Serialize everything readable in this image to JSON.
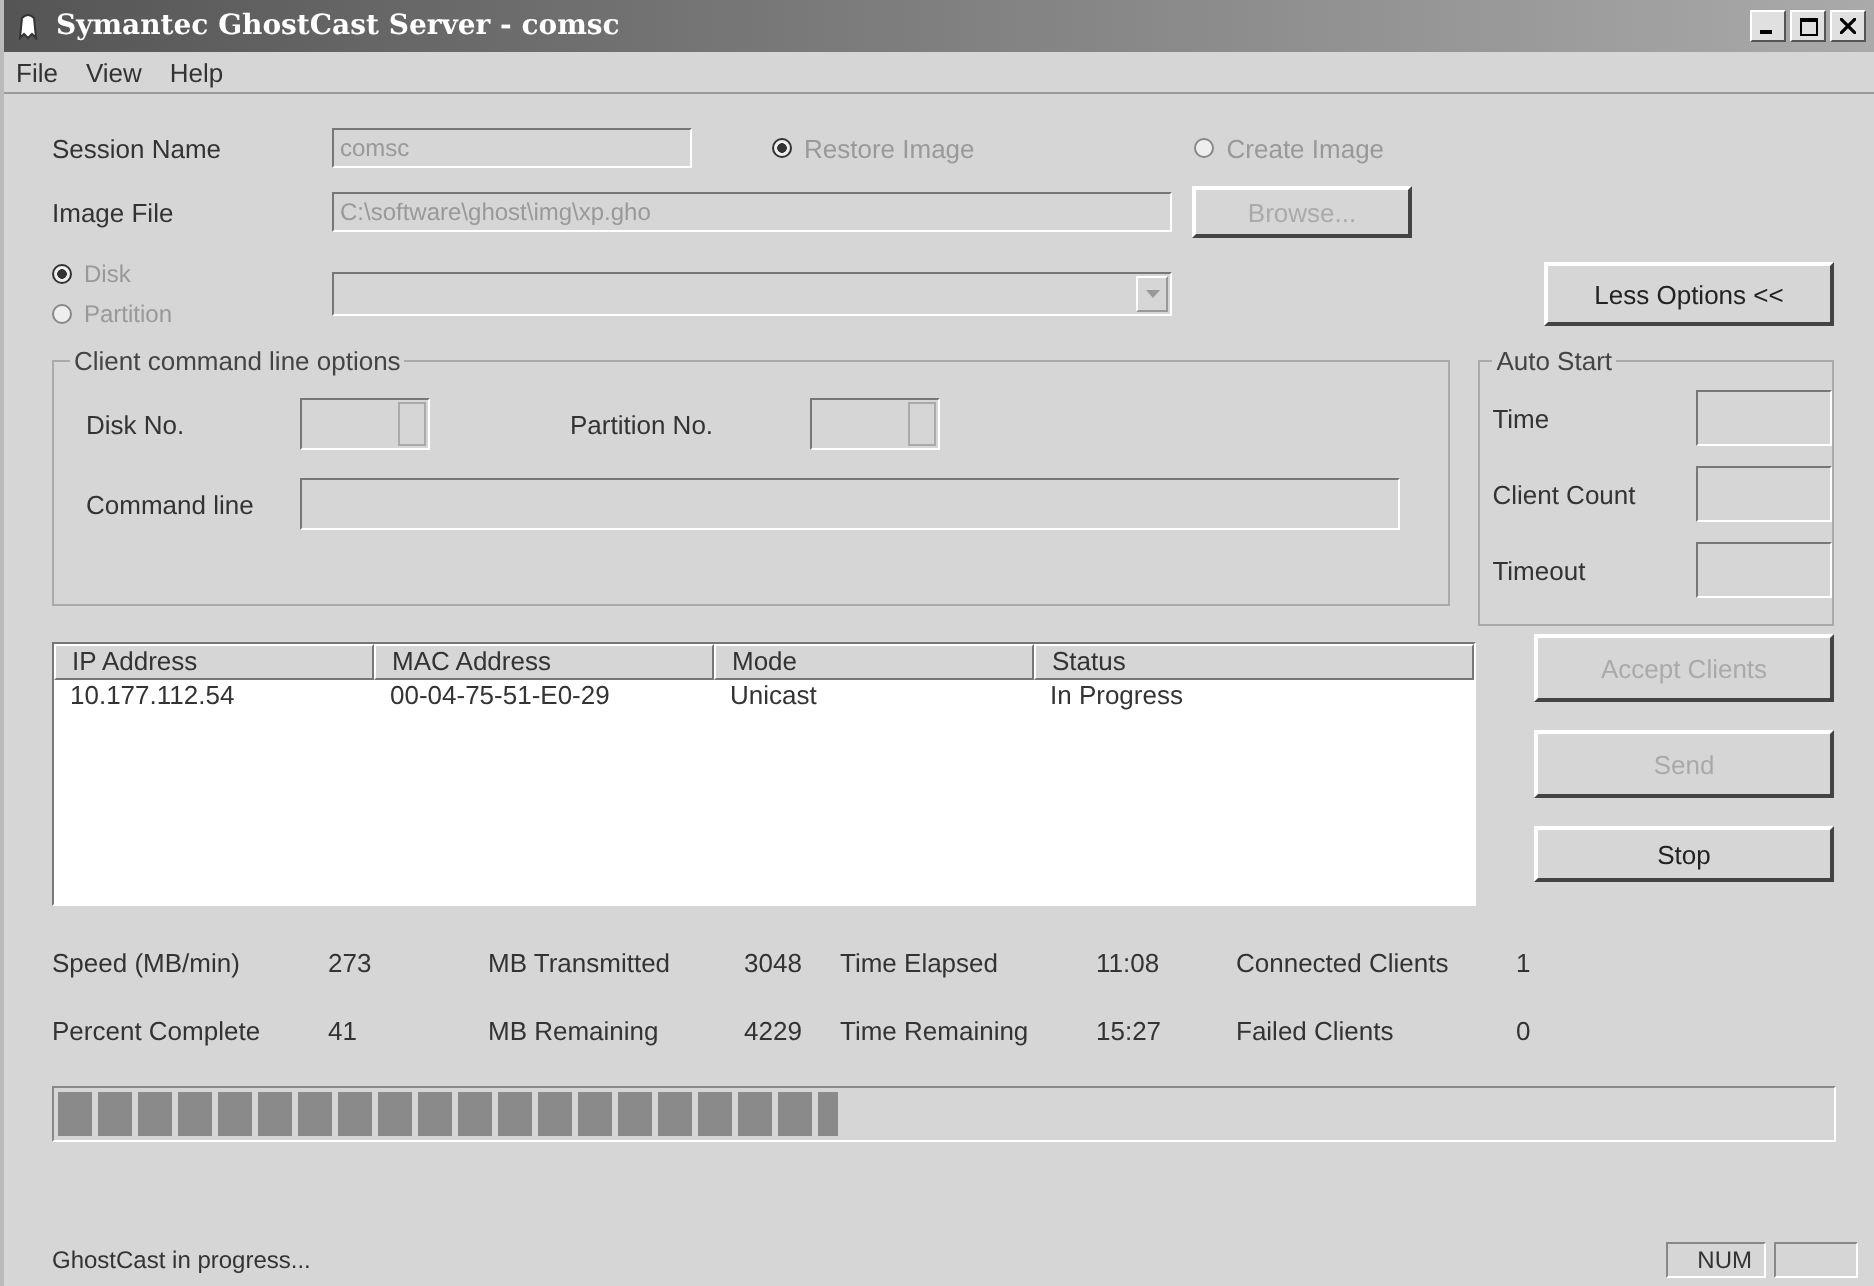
{
  "window": {
    "title": "Symantec GhostCast Server - comsc"
  },
  "menu": [
    "File",
    "View",
    "Help"
  ],
  "session": {
    "label": "Session Name",
    "value": "comsc",
    "disabled": true
  },
  "mode_options": [
    {
      "label": "Restore Image",
      "selected": true,
      "disabled": true
    },
    {
      "label": "Create Image",
      "selected": false,
      "disabled": true
    }
  ],
  "image_file": {
    "label": "Image File",
    "value": "C:\\software\\ghost\\img\\xp.gho",
    "disabled": true
  },
  "browse_button": {
    "label": "Browse...",
    "disabled": true
  },
  "target_options": [
    {
      "label": "Disk",
      "selected": true,
      "disabled": true
    },
    {
      "label": "Partition",
      "selected": false,
      "disabled": true
    }
  ],
  "options_button": {
    "label": "Less Options <<"
  },
  "client_options": {
    "title": "Client command line options",
    "disk_label": "Disk No.",
    "partition_label": "Partition No.",
    "command_label": "Command line"
  },
  "auto_start": {
    "title": "Auto Start",
    "fields": [
      "Time",
      "Client Count",
      "Timeout"
    ]
  },
  "table": {
    "columns": [
      "IP Address",
      "MAC Address",
      "Mode",
      "Status"
    ],
    "rows": [
      [
        "10.177.112.54",
        "00-04-75-51-E0-29",
        "Unicast",
        "In Progress"
      ]
    ]
  },
  "buttons": [
    {
      "label": "Accept Clients",
      "disabled": true
    },
    {
      "label": "Send",
      "disabled": true
    },
    {
      "label": "Stop",
      "disabled": false
    }
  ],
  "stats": [
    [
      {
        "label": "Speed (MB/min)",
        "value": "273"
      },
      {
        "label": "MB Transmitted",
        "value": "3048"
      },
      {
        "label": "Time Elapsed",
        "value": "11:08"
      },
      {
        "label": "Connected Clients",
        "value": "1"
      }
    ],
    [
      {
        "label": "Percent Complete",
        "value": "41"
      },
      {
        "label": "MB Remaining",
        "value": "4229"
      },
      {
        "label": "Time Remaining",
        "value": "15:27"
      },
      {
        "label": "Failed Clients",
        "value": "0"
      }
    ]
  ],
  "progress": {
    "level": 0.44
  },
  "status_bar": {
    "message": "GhostCast in progress...",
    "indicator": "NUM"
  }
}
